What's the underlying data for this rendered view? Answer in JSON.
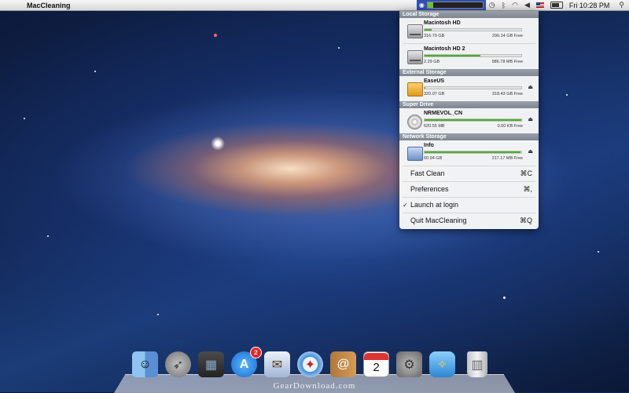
{
  "menubar": {
    "apple_glyph": "",
    "app_name": "MacCleaning",
    "clock": "Fri 10:28 PM",
    "status_usage_fraction": 0.1
  },
  "menu": {
    "sections": [
      {
        "header": "Local Storage",
        "drives": [
          {
            "name": "Macintosh HD",
            "size": "316.79 GB",
            "free": "296.14 GB Free",
            "used_fraction": 0.07,
            "icon": "hard-drive-icon"
          },
          {
            "name": "Macintosh HD 2",
            "size": "2.29 GB",
            "free": "986.78 MB Free",
            "used_fraction": 0.58,
            "icon": "hard-drive-icon"
          }
        ]
      },
      {
        "header": "External Storage",
        "drives": [
          {
            "name": "EaseUS",
            "size": "320.07 GB",
            "free": "318.43 GB Free",
            "used_fraction": 0.01,
            "icon": "external-drive-icon"
          }
        ]
      },
      {
        "header": "Super Drive",
        "drives": [
          {
            "name": "NRMEVOL_CN",
            "size": "620.55 MB",
            "free": "0.00 KB Free",
            "used_fraction": 1.0,
            "icon": "cd-icon"
          }
        ]
      },
      {
        "header": "Network Storage",
        "drives": [
          {
            "name": "Info",
            "size": "60.94 GB",
            "free": "217.17 MB Free",
            "used_fraction": 0.99,
            "icon": "network-drive-icon"
          }
        ]
      }
    ],
    "items": [
      {
        "label": "Fast Clean",
        "shortcut": "⌘C",
        "checked": false
      },
      {
        "label": "Preferences",
        "shortcut": "⌘,",
        "checked": false
      },
      {
        "label": "Launch at login",
        "shortcut": "",
        "checked": true
      },
      {
        "label": "Quit MacCleaning",
        "shortcut": "⌘Q",
        "checked": false
      }
    ],
    "eject_glyph": "⏏"
  },
  "dock": {
    "items": [
      "finder",
      "launchpad",
      "mission-control",
      "app-store",
      "mail",
      "safari",
      "contacts",
      "calendar",
      "system-preferences",
      "maccleaning",
      "trash"
    ],
    "app_store_badge": "2",
    "calendar_day": "2"
  },
  "watermark": "GearDownload.com",
  "colors": {
    "accent": "#2f4fb5",
    "bar_fill": "#4cae2f"
  }
}
